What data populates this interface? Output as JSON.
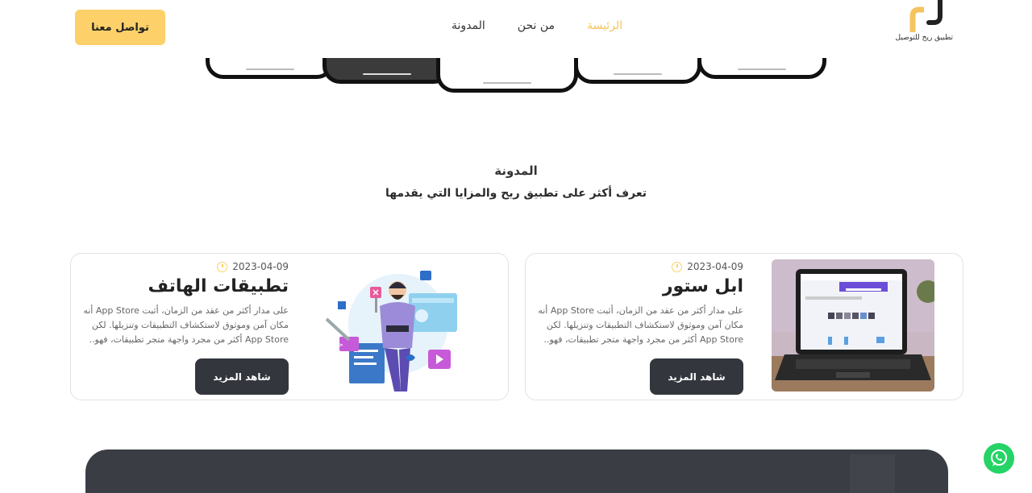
{
  "header": {
    "logo_text": "تطبيق ريح للتوصيل",
    "nav": [
      {
        "label": "الرئيسة",
        "active": true
      },
      {
        "label": "من نحن",
        "active": false
      },
      {
        "label": "المدونة",
        "active": false
      }
    ],
    "cta_label": "تواصل معنا"
  },
  "section": {
    "title": "المدونة",
    "subtitle": "تعرف أكثر على تطبيق ريح والمزايا التي يقدمها"
  },
  "posts": [
    {
      "date": "2023-04-09",
      "title": "ابل ستور",
      "excerpt": "على مدار أكثر من عقد من الزمان، أثبت App Store أنه مكان آمن وموثوق لاستكشاف التطبيقات وتنزيلها. لكن App Store أكثر من مجرد واجهة متجر تطبيقات، فهو..",
      "button": "شاهد المزيد",
      "image_icon": "laptop-app-store-photo"
    },
    {
      "date": "2023-04-09",
      "title": "تطبيقات الهاتف",
      "excerpt": "على مدار أكثر من عقد من الزمان، أثبت App Store أنه مكان آمن وموثوق لاستكشاف التطبيقات وتنزيلها. لكن App Store أكثر من مجرد واجهة متجر تطبيقات، فهو..",
      "button": "شاهد المزيد",
      "image_icon": "developer-illustration"
    }
  ],
  "colors": {
    "accent": "#fdd069",
    "nav_active": "#f5c45e",
    "dark": "#33363d",
    "whatsapp": "#25d366"
  },
  "icons": {
    "clock": "clock-icon",
    "whatsapp": "whatsapp-icon"
  }
}
